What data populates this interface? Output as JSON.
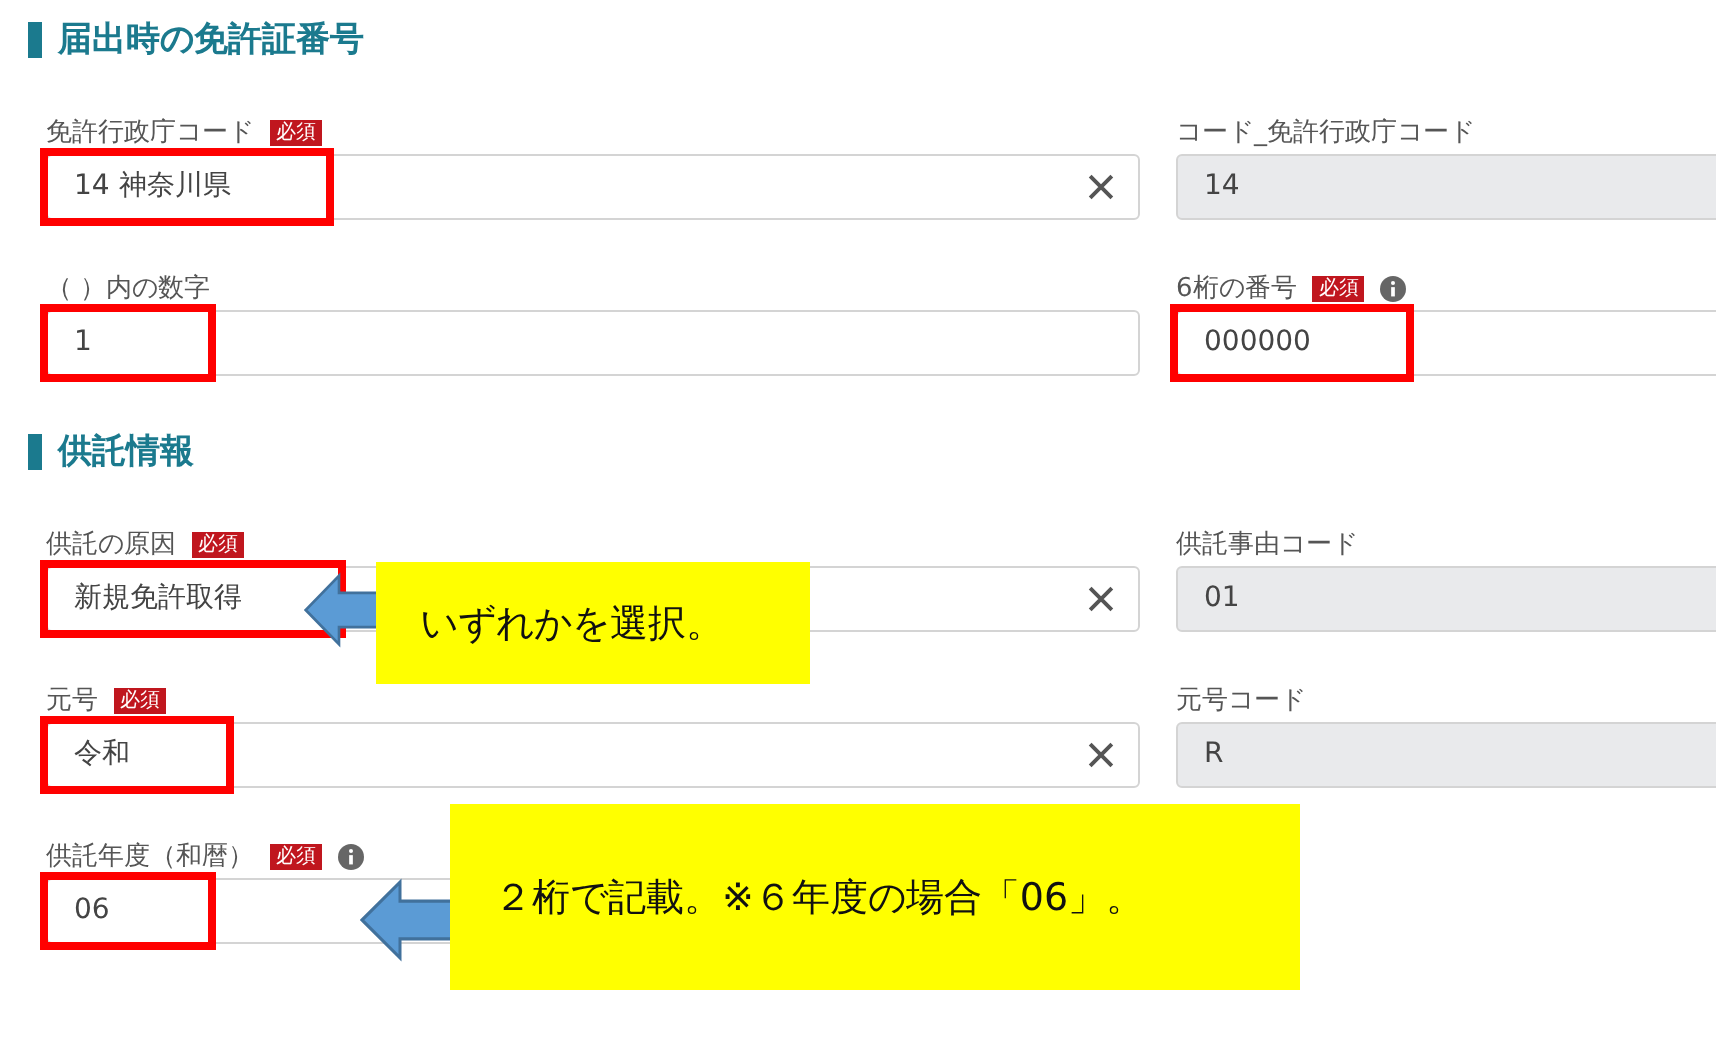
{
  "sections": [
    {
      "title": "届出時の免許証番号",
      "rows": [
        [
          {
            "label": "免許行政庁コード",
            "badge": "必須",
            "info": false,
            "kind": "select",
            "value": "14 神奈川県",
            "highlighted": true
          },
          {
            "label": "コード_免許行政庁コード",
            "info": false,
            "kind": "readonly",
            "value": "14",
            "highlighted": false
          }
        ],
        [
          {
            "label": "（ ）内の数字",
            "info": false,
            "kind": "text",
            "value": "1",
            "highlighted": true
          },
          {
            "label": "6桁の番号",
            "badge": "必須",
            "info": true,
            "kind": "text",
            "value": "000000",
            "highlighted": true
          }
        ]
      ]
    },
    {
      "title": "供託情報",
      "rows": [
        [
          {
            "label": "供託の原因",
            "badge": "必須",
            "info": false,
            "kind": "select",
            "value": "新規免許取得",
            "highlighted": true,
            "note": "いずれかを選択。"
          },
          {
            "label": "供託事由コード",
            "info": false,
            "kind": "readonly",
            "value": "01",
            "highlighted": false
          }
        ],
        [
          {
            "label": "元号",
            "badge": "必須",
            "info": false,
            "kind": "select",
            "value": "令和",
            "highlighted": true
          },
          {
            "label": "元号コード",
            "info": false,
            "kind": "readonly",
            "value": "R",
            "highlighted": false
          }
        ],
        [
          {
            "label": "供託年度（和暦）",
            "badge": "必須",
            "info": true,
            "kind": "text",
            "value": "06",
            "highlighted": true,
            "note": "２桁で記載。※６年度の場合「06」。"
          }
        ]
      ]
    }
  ]
}
